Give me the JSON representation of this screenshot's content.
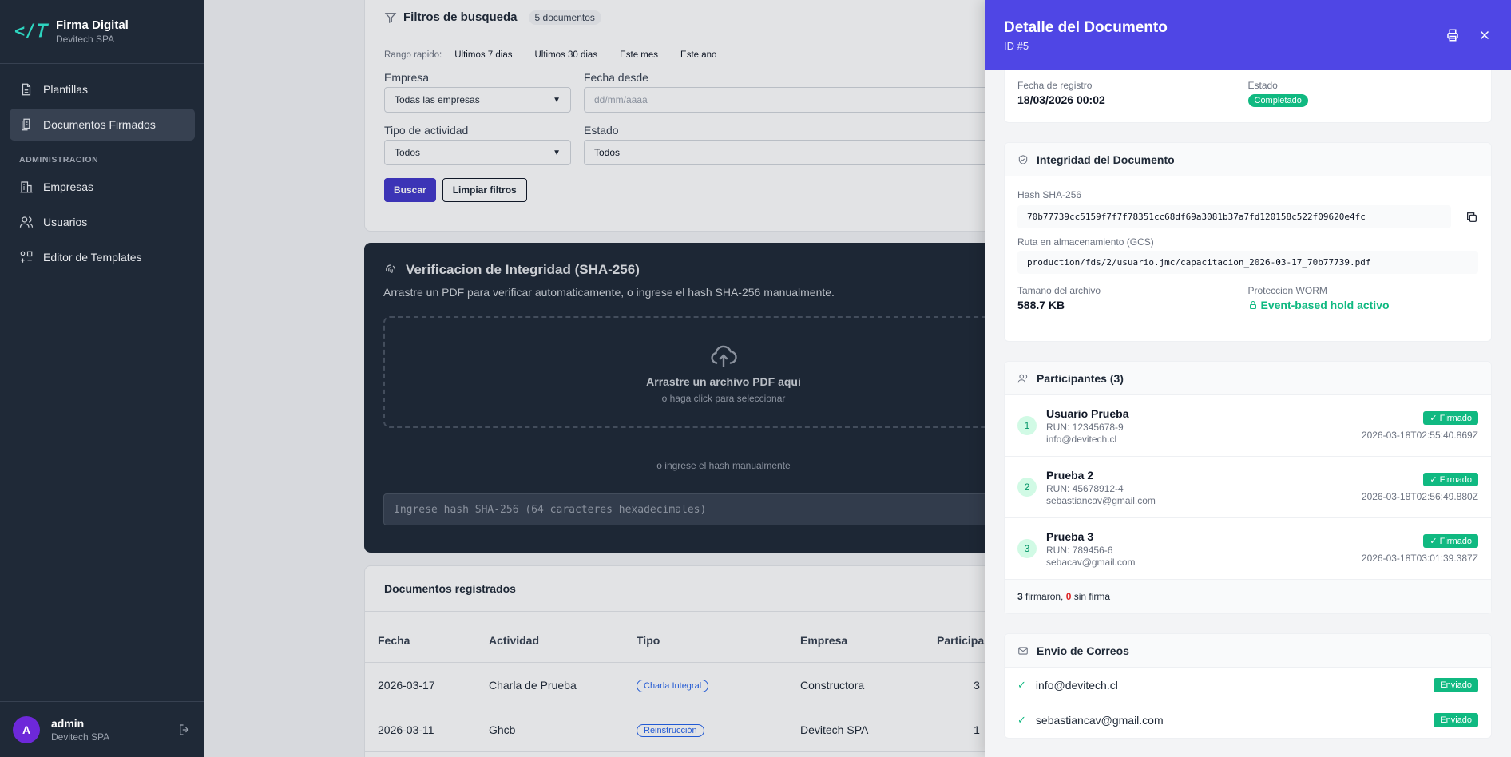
{
  "app": {
    "name": "Firma Digital",
    "company": "Devitech SPA"
  },
  "sidebar": {
    "items": [
      {
        "label": "Plantillas",
        "icon": "document-icon"
      },
      {
        "label": "Documentos Firmados",
        "icon": "documents-icon"
      }
    ],
    "section_label": "ADMINISTRACION",
    "admin_items": [
      {
        "label": "Empresas",
        "icon": "building-icon"
      },
      {
        "label": "Usuarios",
        "icon": "users-icon"
      },
      {
        "label": "Editor de Templates",
        "icon": "template-icon"
      }
    ],
    "user": {
      "initial": "A",
      "name": "admin",
      "company": "Devitech SPA"
    }
  },
  "filters": {
    "title": "Filtros de busqueda",
    "count_badge": "5 documentos",
    "quick_label": "Rango rapido:",
    "quick_options": [
      "Ultimos 7 dias",
      "Ultimos 30 dias",
      "Este mes",
      "Este ano"
    ],
    "empresa_label": "Empresa",
    "empresa_value": "Todas las empresas",
    "fecha_desde_label": "Fecha desde",
    "fecha_desde_placeholder": "dd/mm/aaaa",
    "tipo_label": "Tipo de actividad",
    "tipo_value": "Todos",
    "estado_label": "Estado",
    "estado_value": "Todos",
    "search_button": "Buscar",
    "clear_button": "Limpiar filtros"
  },
  "verify": {
    "title": "Verificacion de Integridad (SHA-256)",
    "description": "Arrastre un PDF para verificar automaticamente, o ingrese el hash SHA-256 manualmente.",
    "drop_title": "Arrastre un archivo PDF aqui",
    "drop_sub": "o haga click para seleccionar",
    "or_manual": "o ingrese el hash manualmente",
    "hash_placeholder": "Ingrese hash SHA-256 (64 caracteres hexadecimales)"
  },
  "docs": {
    "title": "Documentos registrados",
    "columns": [
      "Fecha",
      "Actividad",
      "Tipo",
      "Empresa",
      "Participar"
    ],
    "rows": [
      {
        "fecha": "2026-03-17",
        "actividad": "Charla de Prueba",
        "tipo": "Charla Integral",
        "empresa": "Constructora",
        "participantes": "3"
      },
      {
        "fecha": "2026-03-11",
        "actividad": "Ghcb",
        "tipo": "Reinstrucción",
        "empresa": "Devitech SPA",
        "participantes": "1"
      }
    ]
  },
  "drawer": {
    "title": "Detalle del Documento",
    "id": "ID #5",
    "fecha_registro_label": "Fecha de registro",
    "fecha_registro": "18/03/2026 00:02",
    "estado_label": "Estado",
    "estado": "Completado",
    "integridad": {
      "title": "Integridad del Documento",
      "hash_label": "Hash SHA-256",
      "hash": "70b77739cc5159f7f7f78351cc68df69a3081b37a7fd120158c522f09620e4fc",
      "ruta_label": "Ruta en almacenamiento (GCS)",
      "ruta": "production/fds/2/usuario.jmc/capacitacion_2026-03-17_70b77739.pdf",
      "size_label": "Tamano del archivo",
      "size": "588.7 KB",
      "worm_label": "Proteccion WORM",
      "worm": "Event-based hold activo"
    },
    "participantes": {
      "title": "Participantes (3)",
      "items": [
        {
          "n": "1",
          "name": "Usuario Prueba",
          "run": "RUN: 12345678-9",
          "email": "info@devitech.cl",
          "status": "✓ Firmado",
          "ts": "2026-03-18T02:55:40.869Z"
        },
        {
          "n": "2",
          "name": "Prueba 2",
          "run": "RUN: 45678912-4",
          "email": "sebastiancav@gmail.com",
          "status": "✓ Firmado",
          "ts": "2026-03-18T02:56:49.880Z"
        },
        {
          "n": "3",
          "name": "Prueba 3",
          "run": "RUN: 789456-6",
          "email": "sebacav@gmail.com",
          "status": "✓ Firmado",
          "ts": "2026-03-18T03:01:39.387Z"
        }
      ],
      "signed_count": "3",
      "signed_text": "firmaron,",
      "unsigned_count": "0",
      "unsigned_text": "sin firma"
    },
    "correos": {
      "title": "Envio de Correos",
      "items": [
        {
          "email": "info@devitech.cl",
          "status": "Enviado"
        },
        {
          "email": "sebastiancav@gmail.com",
          "status": "Enviado"
        }
      ]
    }
  },
  "colors": {
    "primary": "#4f46e5",
    "success": "#10b981",
    "sidebar": "#1f2937",
    "danger": "#dc2626"
  }
}
